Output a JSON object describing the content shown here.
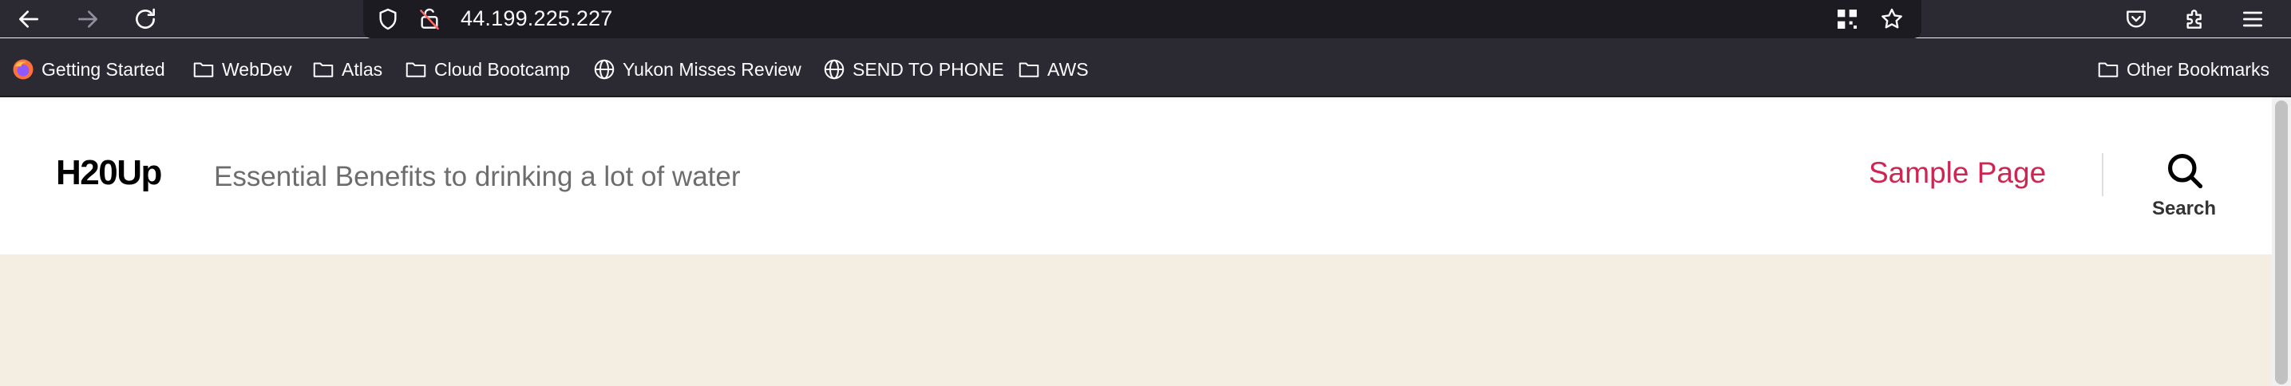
{
  "toolbar": {
    "url": "44.199.225.227"
  },
  "bookmarks": [
    {
      "label": "Getting Started",
      "icon": "firefox-icon"
    },
    {
      "label": "WebDev",
      "icon": "folder-icon"
    },
    {
      "label": "Atlas",
      "icon": "folder-icon"
    },
    {
      "label": "Cloud Bootcamp",
      "icon": "folder-icon"
    },
    {
      "label": "Yukon Misses Review",
      "icon": "globe-icon"
    },
    {
      "label": "SEND TO PHONE",
      "icon": "globe-icon"
    },
    {
      "label": "AWS",
      "icon": "folder-icon"
    }
  ],
  "other_bookmarks": {
    "label": "Other Bookmarks",
    "icon": "folder-icon"
  },
  "site": {
    "title": "H20Up",
    "description": "Essential Benefits to drinking a lot of water",
    "nav": [
      {
        "label": "Sample Page"
      }
    ],
    "search_label": "Search"
  },
  "colors": {
    "toolbar_bg": "#2b2a33",
    "urlbar_bg": "#1c1b22",
    "accent": "#cd2653",
    "page_bg": "#f4ede1"
  }
}
